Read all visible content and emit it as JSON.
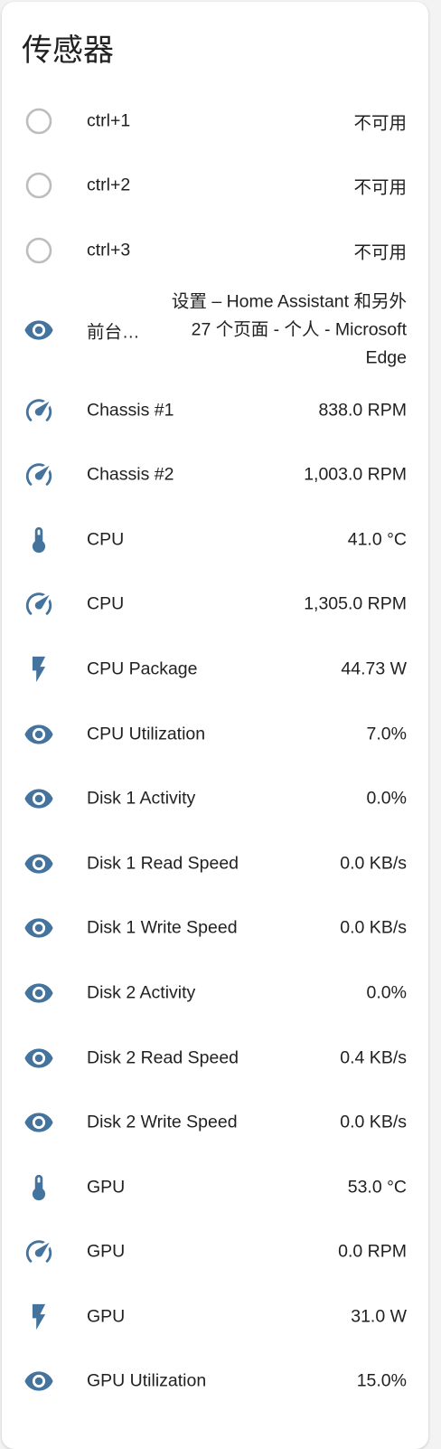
{
  "card": {
    "title": "传感器"
  },
  "colors": {
    "icon_active": "#44739e",
    "icon_unavailable": "#bdbdbd",
    "text": "#212121"
  },
  "rows": [
    {
      "icon": "circle-outline-icon",
      "name": "ctrl+1",
      "state": "不可用"
    },
    {
      "icon": "circle-outline-icon",
      "name": "ctrl+2",
      "state": "不可用"
    },
    {
      "icon": "circle-outline-icon",
      "name": "ctrl+3",
      "state": "不可用"
    },
    {
      "icon": "eye-icon",
      "name": "前台…",
      "state": "设置 – Home Assistant 和另外 27 个页面 - 个人 - Microsoft Edge"
    },
    {
      "icon": "speedometer-icon",
      "name": "Chassis #1",
      "state": "838.0 RPM"
    },
    {
      "icon": "speedometer-icon",
      "name": "Chassis #2",
      "state": "1,003.0 RPM"
    },
    {
      "icon": "thermometer-icon",
      "name": "CPU",
      "state": "41.0 °C"
    },
    {
      "icon": "speedometer-icon",
      "name": "CPU",
      "state": "1,305.0 RPM"
    },
    {
      "icon": "flash-icon",
      "name": "CPU Package",
      "state": "44.73 W"
    },
    {
      "icon": "eye-icon",
      "name": "CPU Utilization",
      "state": "7.0%"
    },
    {
      "icon": "eye-icon",
      "name": "Disk 1 Activity",
      "state": "0.0%"
    },
    {
      "icon": "eye-icon",
      "name": "Disk 1 Read Speed",
      "state": "0.0 KB/s"
    },
    {
      "icon": "eye-icon",
      "name": "Disk 1 Write Speed",
      "state": "0.0 KB/s"
    },
    {
      "icon": "eye-icon",
      "name": "Disk 2 Activity",
      "state": "0.0%"
    },
    {
      "icon": "eye-icon",
      "name": "Disk 2 Read Speed",
      "state": "0.4 KB/s"
    },
    {
      "icon": "eye-icon",
      "name": "Disk 2 Write Speed",
      "state": "0.0 KB/s"
    },
    {
      "icon": "thermometer-icon",
      "name": "GPU",
      "state": "53.0 °C"
    },
    {
      "icon": "speedometer-icon",
      "name": "GPU",
      "state": "0.0 RPM"
    },
    {
      "icon": "flash-icon",
      "name": "GPU",
      "state": "31.0 W"
    },
    {
      "icon": "eye-icon",
      "name": "GPU Utilization",
      "state": "15.0%"
    }
  ]
}
